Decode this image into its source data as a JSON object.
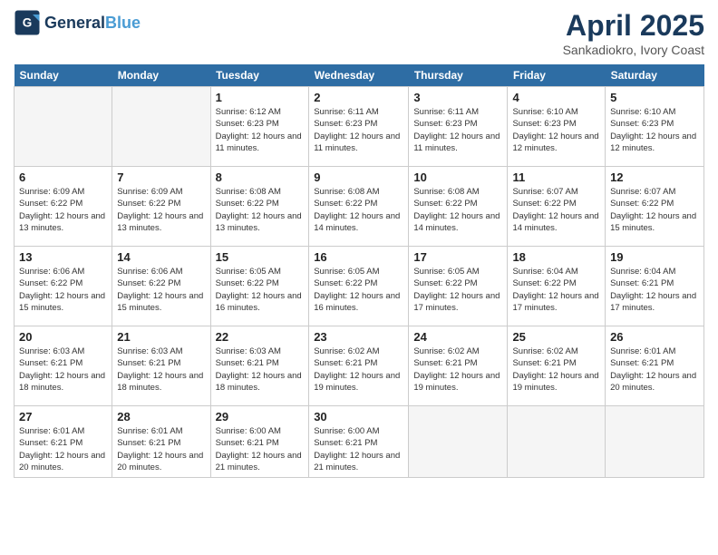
{
  "header": {
    "logo_general": "General",
    "logo_blue": "Blue",
    "month_title": "April 2025",
    "subtitle": "Sankadiokro, Ivory Coast"
  },
  "days_of_week": [
    "Sunday",
    "Monday",
    "Tuesday",
    "Wednesday",
    "Thursday",
    "Friday",
    "Saturday"
  ],
  "weeks": [
    [
      {
        "day": "",
        "info": ""
      },
      {
        "day": "",
        "info": ""
      },
      {
        "day": "1",
        "info": "Sunrise: 6:12 AM\nSunset: 6:23 PM\nDaylight: 12 hours\nand 11 minutes."
      },
      {
        "day": "2",
        "info": "Sunrise: 6:11 AM\nSunset: 6:23 PM\nDaylight: 12 hours\nand 11 minutes."
      },
      {
        "day": "3",
        "info": "Sunrise: 6:11 AM\nSunset: 6:23 PM\nDaylight: 12 hours\nand 11 minutes."
      },
      {
        "day": "4",
        "info": "Sunrise: 6:10 AM\nSunset: 6:23 PM\nDaylight: 12 hours\nand 12 minutes."
      },
      {
        "day": "5",
        "info": "Sunrise: 6:10 AM\nSunset: 6:23 PM\nDaylight: 12 hours\nand 12 minutes."
      }
    ],
    [
      {
        "day": "6",
        "info": "Sunrise: 6:09 AM\nSunset: 6:22 PM\nDaylight: 12 hours\nand 13 minutes."
      },
      {
        "day": "7",
        "info": "Sunrise: 6:09 AM\nSunset: 6:22 PM\nDaylight: 12 hours\nand 13 minutes."
      },
      {
        "day": "8",
        "info": "Sunrise: 6:08 AM\nSunset: 6:22 PM\nDaylight: 12 hours\nand 13 minutes."
      },
      {
        "day": "9",
        "info": "Sunrise: 6:08 AM\nSunset: 6:22 PM\nDaylight: 12 hours\nand 14 minutes."
      },
      {
        "day": "10",
        "info": "Sunrise: 6:08 AM\nSunset: 6:22 PM\nDaylight: 12 hours\nand 14 minutes."
      },
      {
        "day": "11",
        "info": "Sunrise: 6:07 AM\nSunset: 6:22 PM\nDaylight: 12 hours\nand 14 minutes."
      },
      {
        "day": "12",
        "info": "Sunrise: 6:07 AM\nSunset: 6:22 PM\nDaylight: 12 hours\nand 15 minutes."
      }
    ],
    [
      {
        "day": "13",
        "info": "Sunrise: 6:06 AM\nSunset: 6:22 PM\nDaylight: 12 hours\nand 15 minutes."
      },
      {
        "day": "14",
        "info": "Sunrise: 6:06 AM\nSunset: 6:22 PM\nDaylight: 12 hours\nand 15 minutes."
      },
      {
        "day": "15",
        "info": "Sunrise: 6:05 AM\nSunset: 6:22 PM\nDaylight: 12 hours\nand 16 minutes."
      },
      {
        "day": "16",
        "info": "Sunrise: 6:05 AM\nSunset: 6:22 PM\nDaylight: 12 hours\nand 16 minutes."
      },
      {
        "day": "17",
        "info": "Sunrise: 6:05 AM\nSunset: 6:22 PM\nDaylight: 12 hours\nand 17 minutes."
      },
      {
        "day": "18",
        "info": "Sunrise: 6:04 AM\nSunset: 6:22 PM\nDaylight: 12 hours\nand 17 minutes."
      },
      {
        "day": "19",
        "info": "Sunrise: 6:04 AM\nSunset: 6:21 PM\nDaylight: 12 hours\nand 17 minutes."
      }
    ],
    [
      {
        "day": "20",
        "info": "Sunrise: 6:03 AM\nSunset: 6:21 PM\nDaylight: 12 hours\nand 18 minutes."
      },
      {
        "day": "21",
        "info": "Sunrise: 6:03 AM\nSunset: 6:21 PM\nDaylight: 12 hours\nand 18 minutes."
      },
      {
        "day": "22",
        "info": "Sunrise: 6:03 AM\nSunset: 6:21 PM\nDaylight: 12 hours\nand 18 minutes."
      },
      {
        "day": "23",
        "info": "Sunrise: 6:02 AM\nSunset: 6:21 PM\nDaylight: 12 hours\nand 19 minutes."
      },
      {
        "day": "24",
        "info": "Sunrise: 6:02 AM\nSunset: 6:21 PM\nDaylight: 12 hours\nand 19 minutes."
      },
      {
        "day": "25",
        "info": "Sunrise: 6:02 AM\nSunset: 6:21 PM\nDaylight: 12 hours\nand 19 minutes."
      },
      {
        "day": "26",
        "info": "Sunrise: 6:01 AM\nSunset: 6:21 PM\nDaylight: 12 hours\nand 20 minutes."
      }
    ],
    [
      {
        "day": "27",
        "info": "Sunrise: 6:01 AM\nSunset: 6:21 PM\nDaylight: 12 hours\nand 20 minutes."
      },
      {
        "day": "28",
        "info": "Sunrise: 6:01 AM\nSunset: 6:21 PM\nDaylight: 12 hours\nand 20 minutes."
      },
      {
        "day": "29",
        "info": "Sunrise: 6:00 AM\nSunset: 6:21 PM\nDaylight: 12 hours\nand 21 minutes."
      },
      {
        "day": "30",
        "info": "Sunrise: 6:00 AM\nSunset: 6:21 PM\nDaylight: 12 hours\nand 21 minutes."
      },
      {
        "day": "",
        "info": ""
      },
      {
        "day": "",
        "info": ""
      },
      {
        "day": "",
        "info": ""
      }
    ]
  ]
}
